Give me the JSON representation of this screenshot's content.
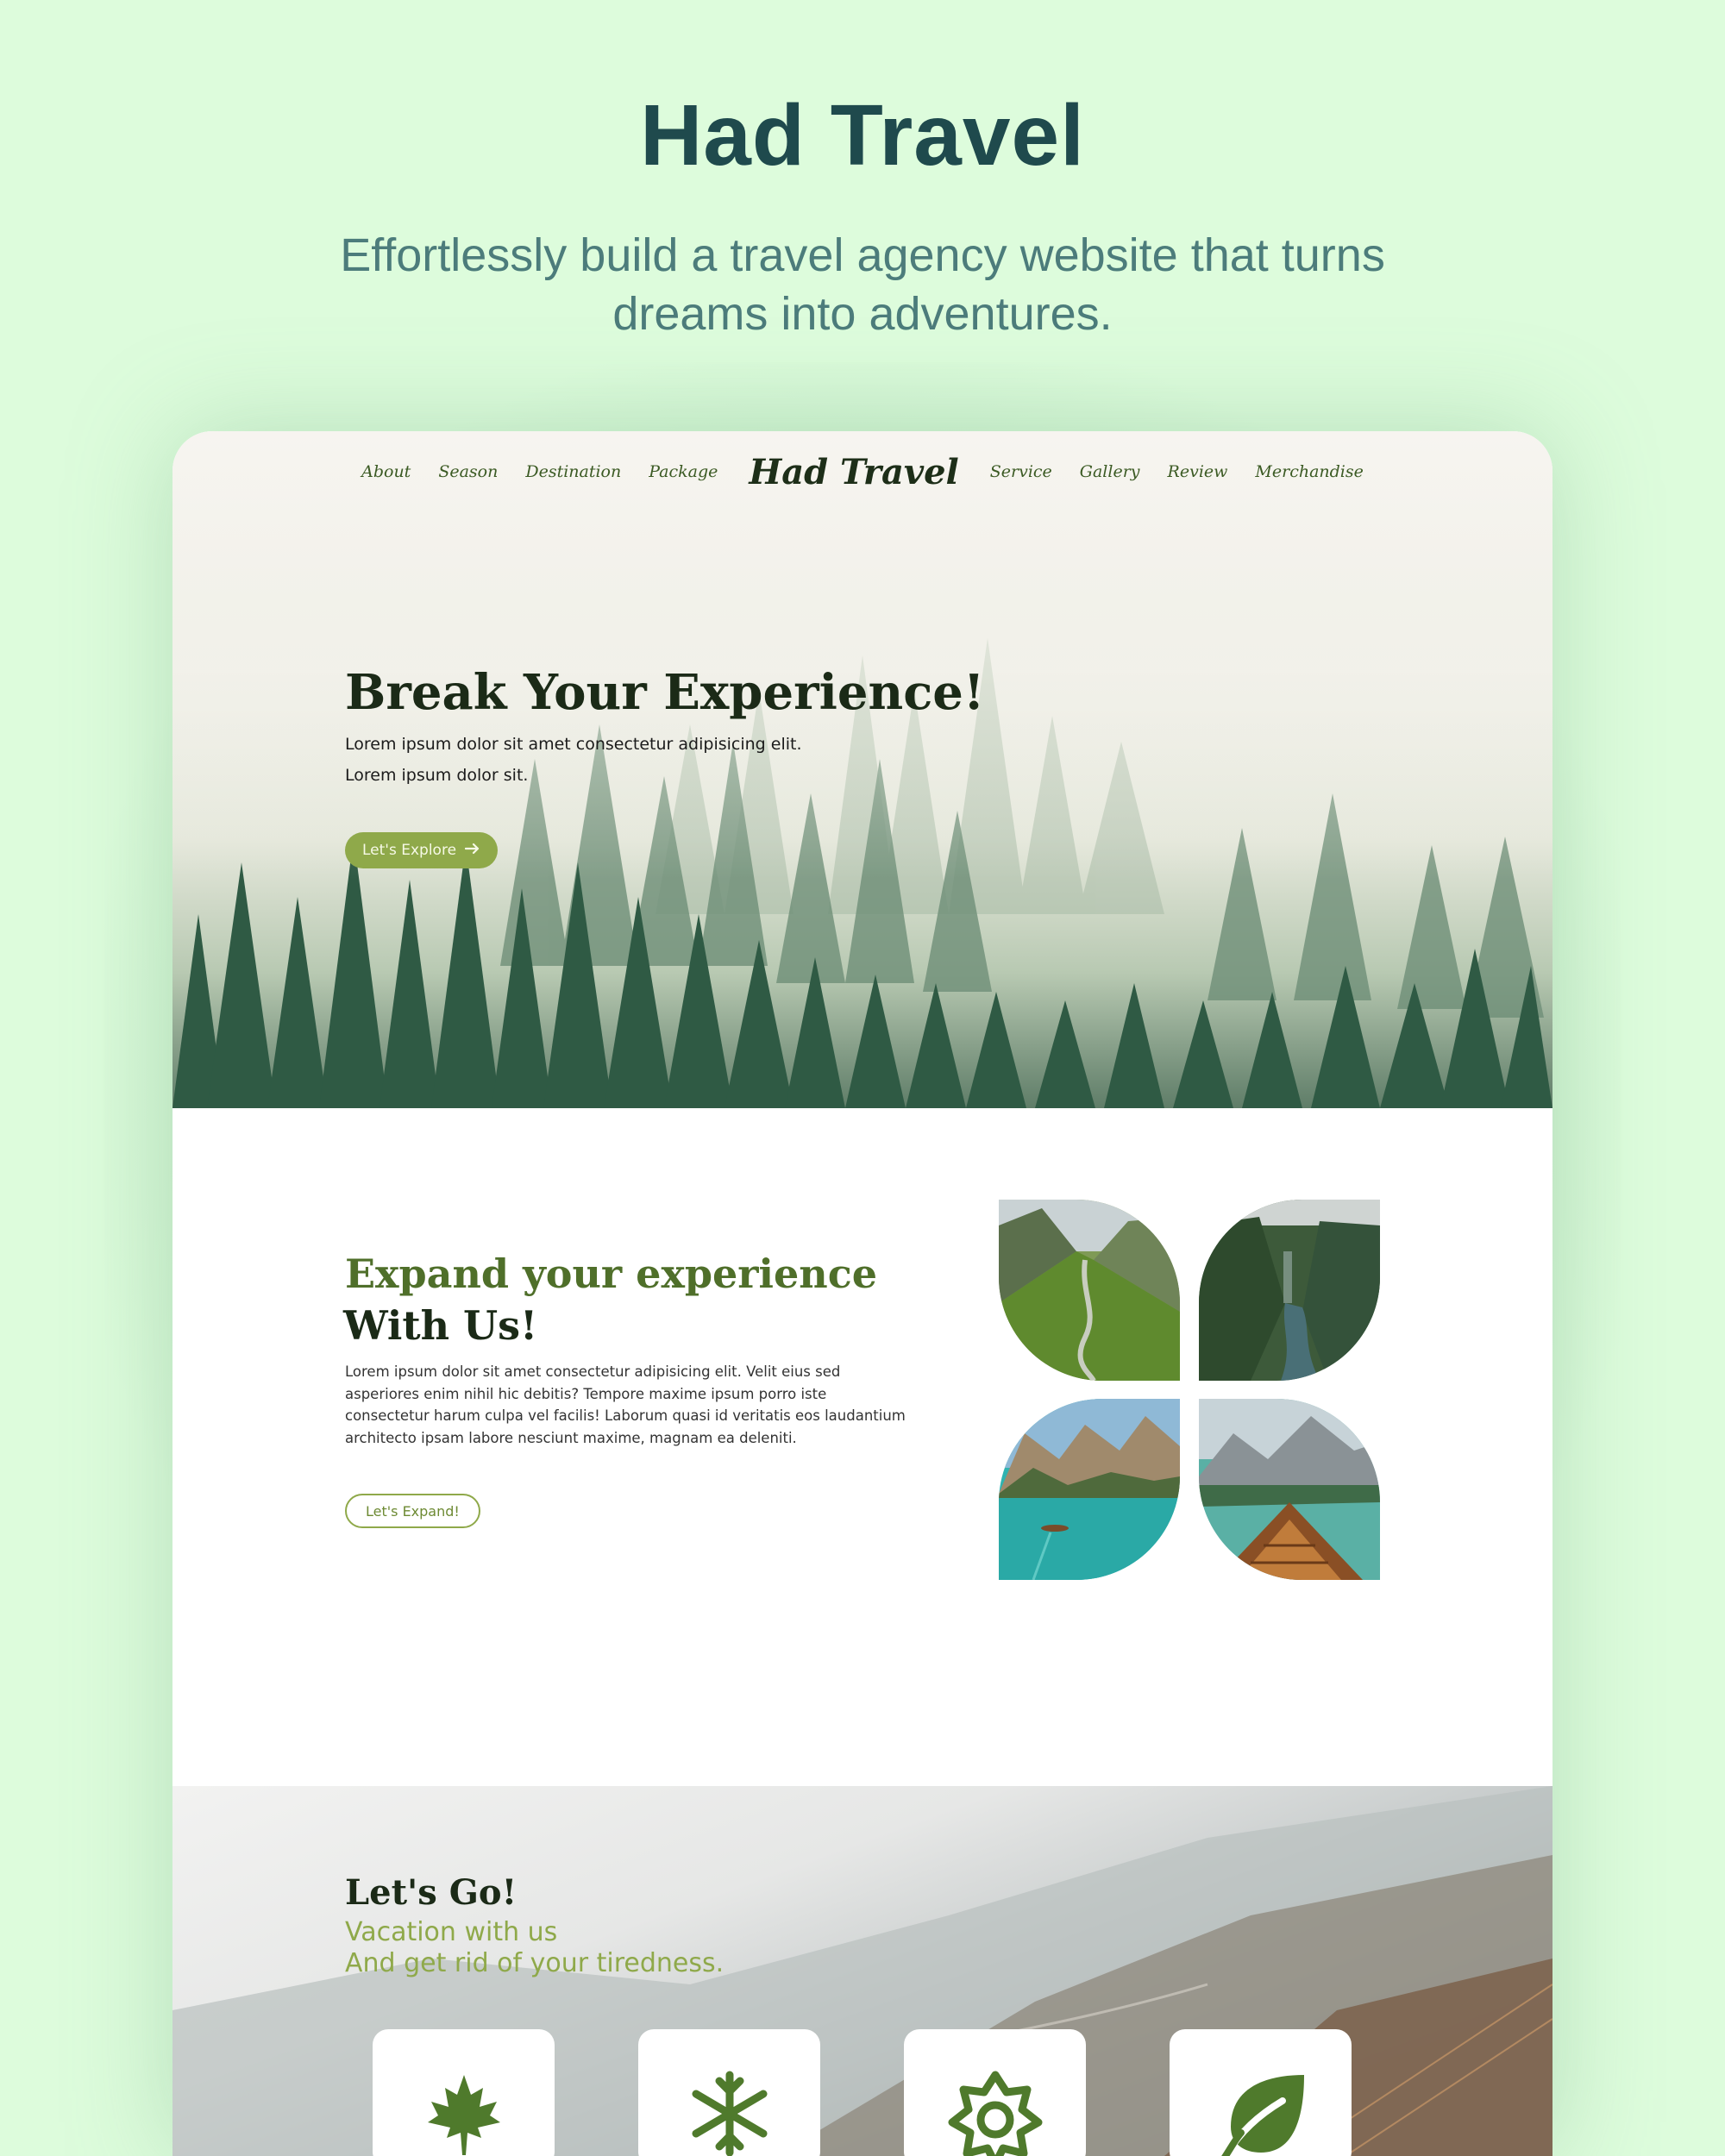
{
  "promo": {
    "title": "Had Travel",
    "tagline": "Effortlessly build a travel agency website that turns dreams into adventures."
  },
  "nav": {
    "left_items": [
      "About",
      "Season",
      "Destination",
      "Package"
    ],
    "brand": "Had Travel",
    "right_items": [
      "Service",
      "Gallery",
      "Review",
      "Merchandise"
    ]
  },
  "hero": {
    "title": "Break Your Experience!",
    "line1": "Lorem ipsum dolor sit amet consectetur adipisicing elit.",
    "line2": "Lorem ipsum dolor sit.",
    "button_label": "Let's Explore"
  },
  "expand": {
    "title": "Expand your experience",
    "subtitle": "With Us!",
    "body": "Lorem ipsum dolor sit amet consectetur adipisicing elit. Velit eius sed asperiores enim nihil hic debitis? Tempore maxime ipsum porro iste consectetur harum culpa vel facilis! Laborum quasi id veritatis eos laudantium architecto ipsam labore nesciunt maxime, magnam ea deleniti.",
    "button_label": "Let's Expand!",
    "gallery": [
      "valley-river",
      "canyon-waterfall",
      "turquoise-lake-boat",
      "wooden-boat-lake"
    ]
  },
  "letsgo": {
    "title": "Let's Go!",
    "line1": "Vacation with us",
    "line2": "And get rid of your tiredness.",
    "cards": [
      "maple-leaf-icon",
      "snowflake-icon",
      "sun-icon",
      "leaf-icon"
    ]
  },
  "colors": {
    "background": "#ddfcdc",
    "promo_title": "#1f4a4d",
    "accent_green": "#8fa94a",
    "dark_green": "#4f6f2a",
    "icon_green": "#4f7a2c"
  }
}
